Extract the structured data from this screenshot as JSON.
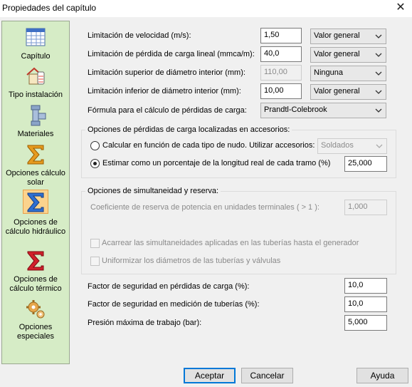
{
  "window": {
    "title": "Propiedades del capítulo",
    "close_glyph": "✕"
  },
  "sidebar": {
    "items": [
      {
        "label": "Capítulo",
        "icon": "table-icon"
      },
      {
        "label": "Tipo instalación",
        "icon": "installation-icon"
      },
      {
        "label": "Materiales",
        "icon": "pipe-fitting-icon"
      },
      {
        "label": "Opciones cálculo solar",
        "icon": "sigma-orange-icon"
      },
      {
        "label": "Opciones de cálculo hidráulico",
        "icon": "sigma-blue-icon",
        "active": true
      },
      {
        "label": "Opciones de cálculo térmico",
        "icon": "sigma-red-icon"
      },
      {
        "label": "Opciones especiales",
        "icon": "gears-icon"
      }
    ]
  },
  "form": {
    "vel_label": "Limitación de velocidad (m/s):",
    "vel_value": "1,50",
    "vel_mode": "Valor general",
    "loss_label": "Limitación de pérdida de carga lineal (mmca/m):",
    "loss_value": "40,0",
    "loss_mode": "Valor general",
    "dmax_label": "Limitación superior de diámetro interior (mm):",
    "dmax_value": "110,00",
    "dmax_mode": "Ninguna",
    "dmin_label": "Limitación inferior de diámetro interior (mm):",
    "dmin_value": "10,00",
    "dmin_mode": "Valor general",
    "formula_label": "Fórmula para el cálculo de pérdidas de carga:",
    "formula_value": "Prandtl-Colebrook"
  },
  "accessories": {
    "title": "Opciones de pérdidas de carga localizadas en accesorios:",
    "opt1_label": "Calcular en función de cada tipo de nudo. Utilizar accesorios:",
    "opt1_combo": "Soldados",
    "opt1_selected": false,
    "opt2_label": "Estimar como un porcentaje de la longitud real de cada tramo (%)",
    "opt2_value": "25,000",
    "opt2_selected": true
  },
  "simult": {
    "title": "Opciones de simultaneidad y reserva:",
    "coef_label": "Coeficiente de reserva de potencia en unidades terminales ( > 1 ):",
    "coef_value": "1,000",
    "chk1_label": "Acarrear las simultaneidades aplicadas en las tuberías hasta el generador",
    "chk1_checked": false,
    "chk2_label": "Uniformizar los diámetros de las tuberías y válvulas",
    "chk2_checked": false
  },
  "safety": {
    "loss_label": "Factor de seguridad en pérdidas de carga (%):",
    "loss_value": "10,0",
    "meas_label": "Factor de seguridad en medición de tuberías (%):",
    "meas_value": "10,0",
    "press_label": "Presión máxima de trabajo (bar):",
    "press_value": "5,000"
  },
  "buttons": {
    "ok": "Aceptar",
    "cancel": "Cancelar",
    "help": "Ayuda"
  }
}
